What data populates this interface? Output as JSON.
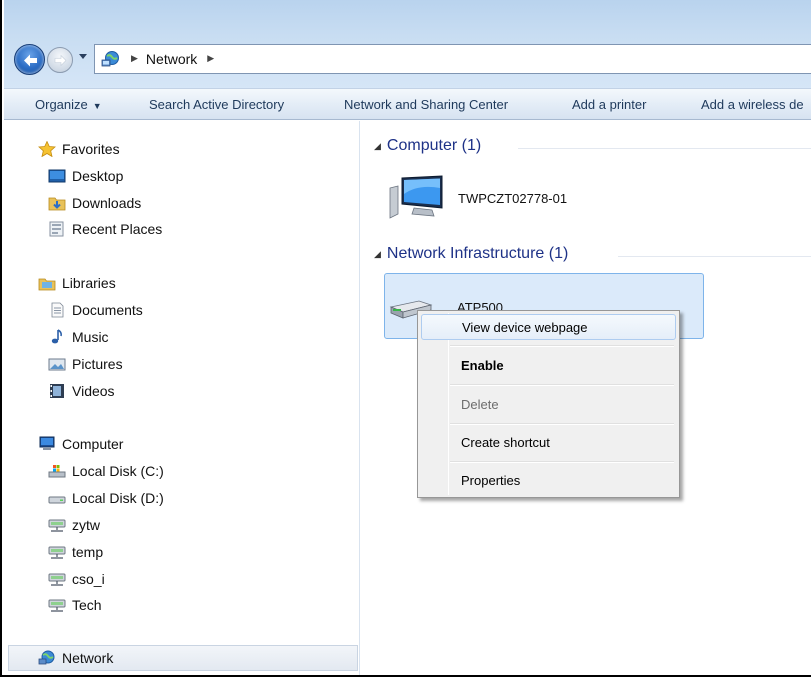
{
  "address_bar": {
    "path": [
      "Network"
    ]
  },
  "toolbar": {
    "organize": "Organize",
    "search_ad": "Search Active Directory",
    "network_sharing": "Network and Sharing Center",
    "add_printer": "Add a printer",
    "add_wireless": "Add a wireless de"
  },
  "nav": {
    "favorites": {
      "header": "Favorites",
      "items": [
        "Desktop",
        "Downloads",
        "Recent Places"
      ]
    },
    "libraries": {
      "header": "Libraries",
      "items": [
        "Documents",
        "Music",
        "Pictures",
        "Videos"
      ]
    },
    "computer": {
      "header": "Computer",
      "items": [
        "Local Disk (C:)",
        "Local Disk (D:)",
        "zytw",
        "temp",
        "cso_i",
        "Tech"
      ]
    },
    "network": "Network"
  },
  "content": {
    "groups": [
      {
        "title": "Computer (1)",
        "items": [
          "TWPCZT02778-01"
        ]
      },
      {
        "title": "Network Infrastructure (1)",
        "items": [
          "ATP500"
        ]
      }
    ]
  },
  "context_menu": {
    "items": [
      "View device webpage",
      "Enable",
      "Delete",
      "Create shortcut",
      "Properties"
    ]
  }
}
